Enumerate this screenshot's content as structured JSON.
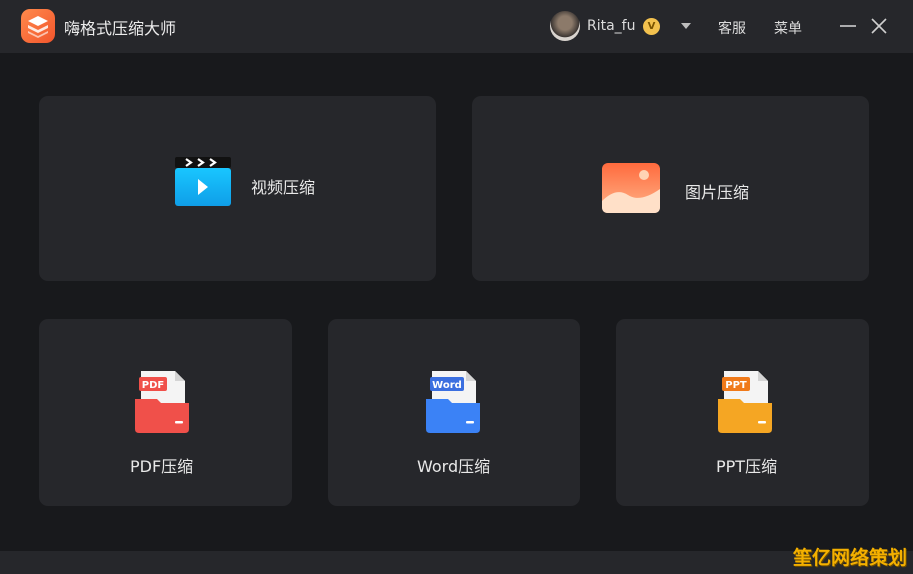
{
  "app": {
    "title": "嗨格式压缩大师"
  },
  "user": {
    "name": "Rita_fu",
    "badge": "V"
  },
  "header": {
    "service_label": "客服",
    "menu_label": "菜单"
  },
  "cards": {
    "video": {
      "label": "视频压缩",
      "icon": "video-file-icon"
    },
    "image": {
      "label": "图片压缩",
      "icon": "image-file-icon"
    },
    "pdf": {
      "label": "PDF压缩",
      "tag": "PDF",
      "icon": "pdf-folder-icon"
    },
    "word": {
      "label": "Word压缩",
      "tag": "Word",
      "icon": "word-folder-icon"
    },
    "ppt": {
      "label": "PPT压缩",
      "tag": "PPT",
      "icon": "ppt-folder-icon"
    }
  },
  "watermark": {
    "text": "筀亿网络策划"
  },
  "colors": {
    "accent": "#f2552c",
    "pdf": "#f0504a",
    "word": "#3b82f6",
    "ppt": "#f5a623",
    "video": "#17b8f5",
    "card_bg": "#26272b",
    "main_bg": "#18191c"
  }
}
